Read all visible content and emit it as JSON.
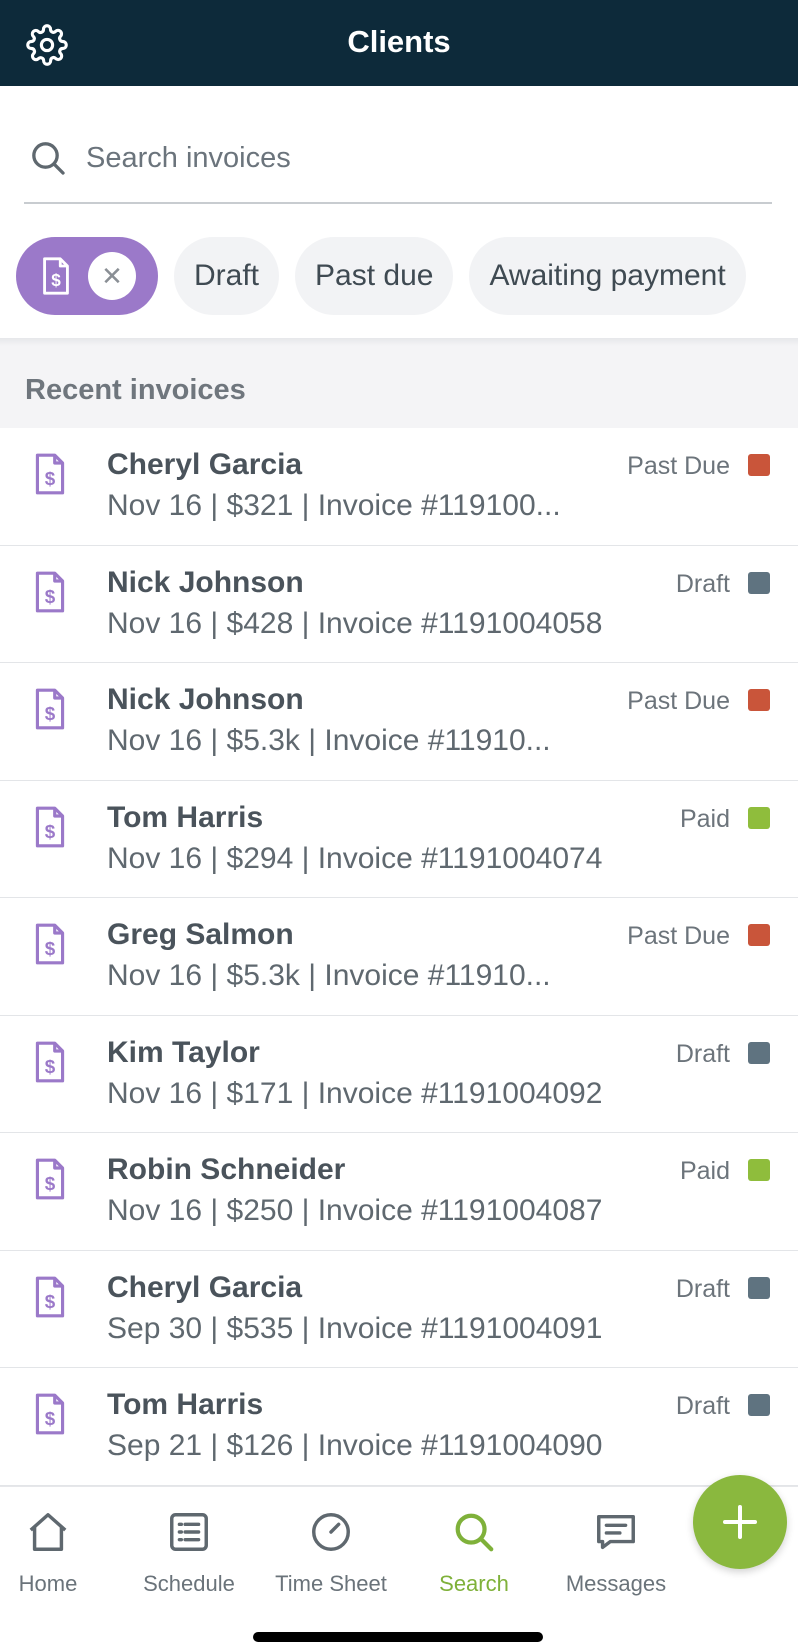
{
  "header": {
    "title": "Clients"
  },
  "search": {
    "placeholder": "Search invoices"
  },
  "filters": [
    {
      "label": "Draft"
    },
    {
      "label": "Past due"
    },
    {
      "label": "Awaiting payment"
    }
  ],
  "section_title": "Recent invoices",
  "status_colors": {
    "Past Due": "#c9553a",
    "Draft": "#5f7380",
    "Paid": "#8fbd3c"
  },
  "invoices": [
    {
      "name": "Cheryl Garcia",
      "detail": "Nov 16 | $321 | Invoice #119100...",
      "status": "Past Due"
    },
    {
      "name": "Nick Johnson",
      "detail": "Nov 16 | $428 | Invoice #1191004058",
      "status": "Draft"
    },
    {
      "name": "Nick Johnson",
      "detail": "Nov 16 | $5.3k | Invoice #11910...",
      "status": "Past Due"
    },
    {
      "name": "Tom Harris",
      "detail": "Nov 16 | $294 | Invoice #1191004074",
      "status": "Paid"
    },
    {
      "name": "Greg Salmon",
      "detail": "Nov 16 | $5.3k | Invoice #11910...",
      "status": "Past Due"
    },
    {
      "name": "Kim Taylor",
      "detail": "Nov 16 | $171 | Invoice #1191004092",
      "status": "Draft"
    },
    {
      "name": "Robin Schneider",
      "detail": "Nov 16 | $250 | Invoice #1191004087",
      "status": "Paid"
    },
    {
      "name": "Cheryl Garcia",
      "detail": "Sep 30 | $535 | Invoice #1191004091",
      "status": "Draft"
    },
    {
      "name": "Tom Harris",
      "detail": "Sep 21 | $126 | Invoice #1191004090",
      "status": "Draft"
    }
  ],
  "tabs": [
    {
      "label": "Home",
      "icon": "home-icon"
    },
    {
      "label": "Schedule",
      "icon": "schedule-icon"
    },
    {
      "label": "Time Sheet",
      "icon": "timesheet-icon"
    },
    {
      "label": "Search",
      "icon": "search-icon",
      "active": true
    },
    {
      "label": "Messages",
      "icon": "messages-icon"
    }
  ],
  "colors": {
    "header_bg": "#0d2a3a",
    "accent_green": "#8ab83e",
    "chip_purple": "#9b79c9",
    "icon_purple": "#9b79c9"
  }
}
